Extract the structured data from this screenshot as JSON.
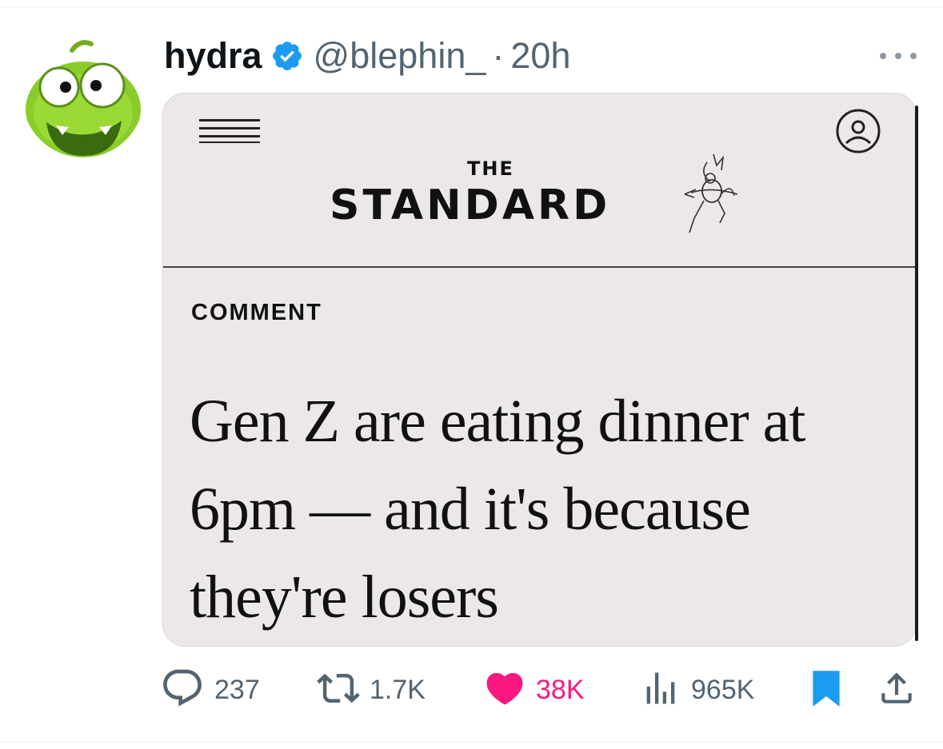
{
  "tweet": {
    "author": {
      "display_name": "hydra",
      "handle": "@blephin_",
      "separator": "·",
      "time": "20h",
      "verified": true
    },
    "card": {
      "masthead_small": "THE",
      "masthead_title": "STANDARD",
      "kicker": "COMMENT",
      "headline": "Gen Z are eating dinner at 6pm — and it's because they're losers"
    },
    "actions": {
      "replies": "237",
      "retweets": "1.7K",
      "likes": "38K",
      "views": "965K"
    }
  },
  "colors": {
    "text_primary": "#0f1419",
    "text_secondary": "#536471",
    "verified_blue": "#1d9bf0",
    "like_pink": "#f91880",
    "bookmark_blue": "#1d9bf0",
    "card_background": "#ede8e8",
    "avatar_green": "#8acd2b"
  },
  "icons": {
    "verified": "verified-badge-icon",
    "more": "more-icon",
    "reply": "reply-icon",
    "retweet": "retweet-icon",
    "like": "heart-icon",
    "views": "views-icon",
    "bookmark": "bookmark-icon",
    "share": "share-icon",
    "menu": "hamburger-menu-icon",
    "account": "account-icon",
    "cupid": "cupid-logo-icon"
  }
}
